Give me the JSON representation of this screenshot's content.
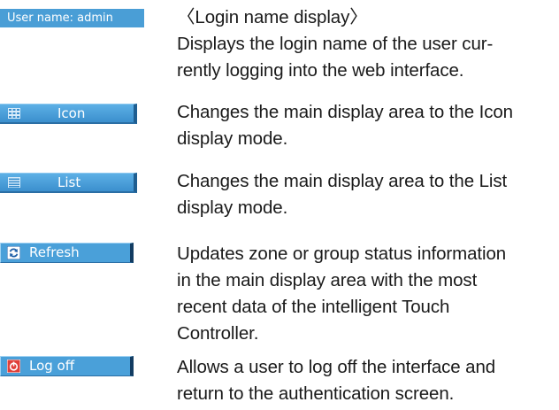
{
  "rows": [
    {
      "control_label": "User name: admin",
      "desc_title": "〈Login name display〉",
      "desc_lines": [
        "Displays the login name of the user cur-",
        "rently logging into the web interface."
      ]
    },
    {
      "control_label": "Icon",
      "icon": "grid-view-icon",
      "desc_lines": [
        "Changes the main display area to the Icon",
        "display mode."
      ]
    },
    {
      "control_label": "List",
      "icon": "list-view-icon",
      "desc_lines": [
        "Changes the main display area to the List",
        "display mode."
      ]
    },
    {
      "control_label": "Refresh",
      "icon": "refresh-icon",
      "desc_lines": [
        "Updates zone or group status information",
        "in the main display area with the most",
        "recent data of the intelligent Touch",
        "Controller."
      ]
    },
    {
      "control_label": "Log off",
      "icon": "power-icon",
      "desc_lines": [
        "Allows a user to log off the interface and",
        "return to the authentication screen."
      ]
    }
  ],
  "colors": {
    "button_blue": "#4a9ed6",
    "refresh_icon": "#1f5fa8",
    "logoff_icon": "#e0403a"
  }
}
